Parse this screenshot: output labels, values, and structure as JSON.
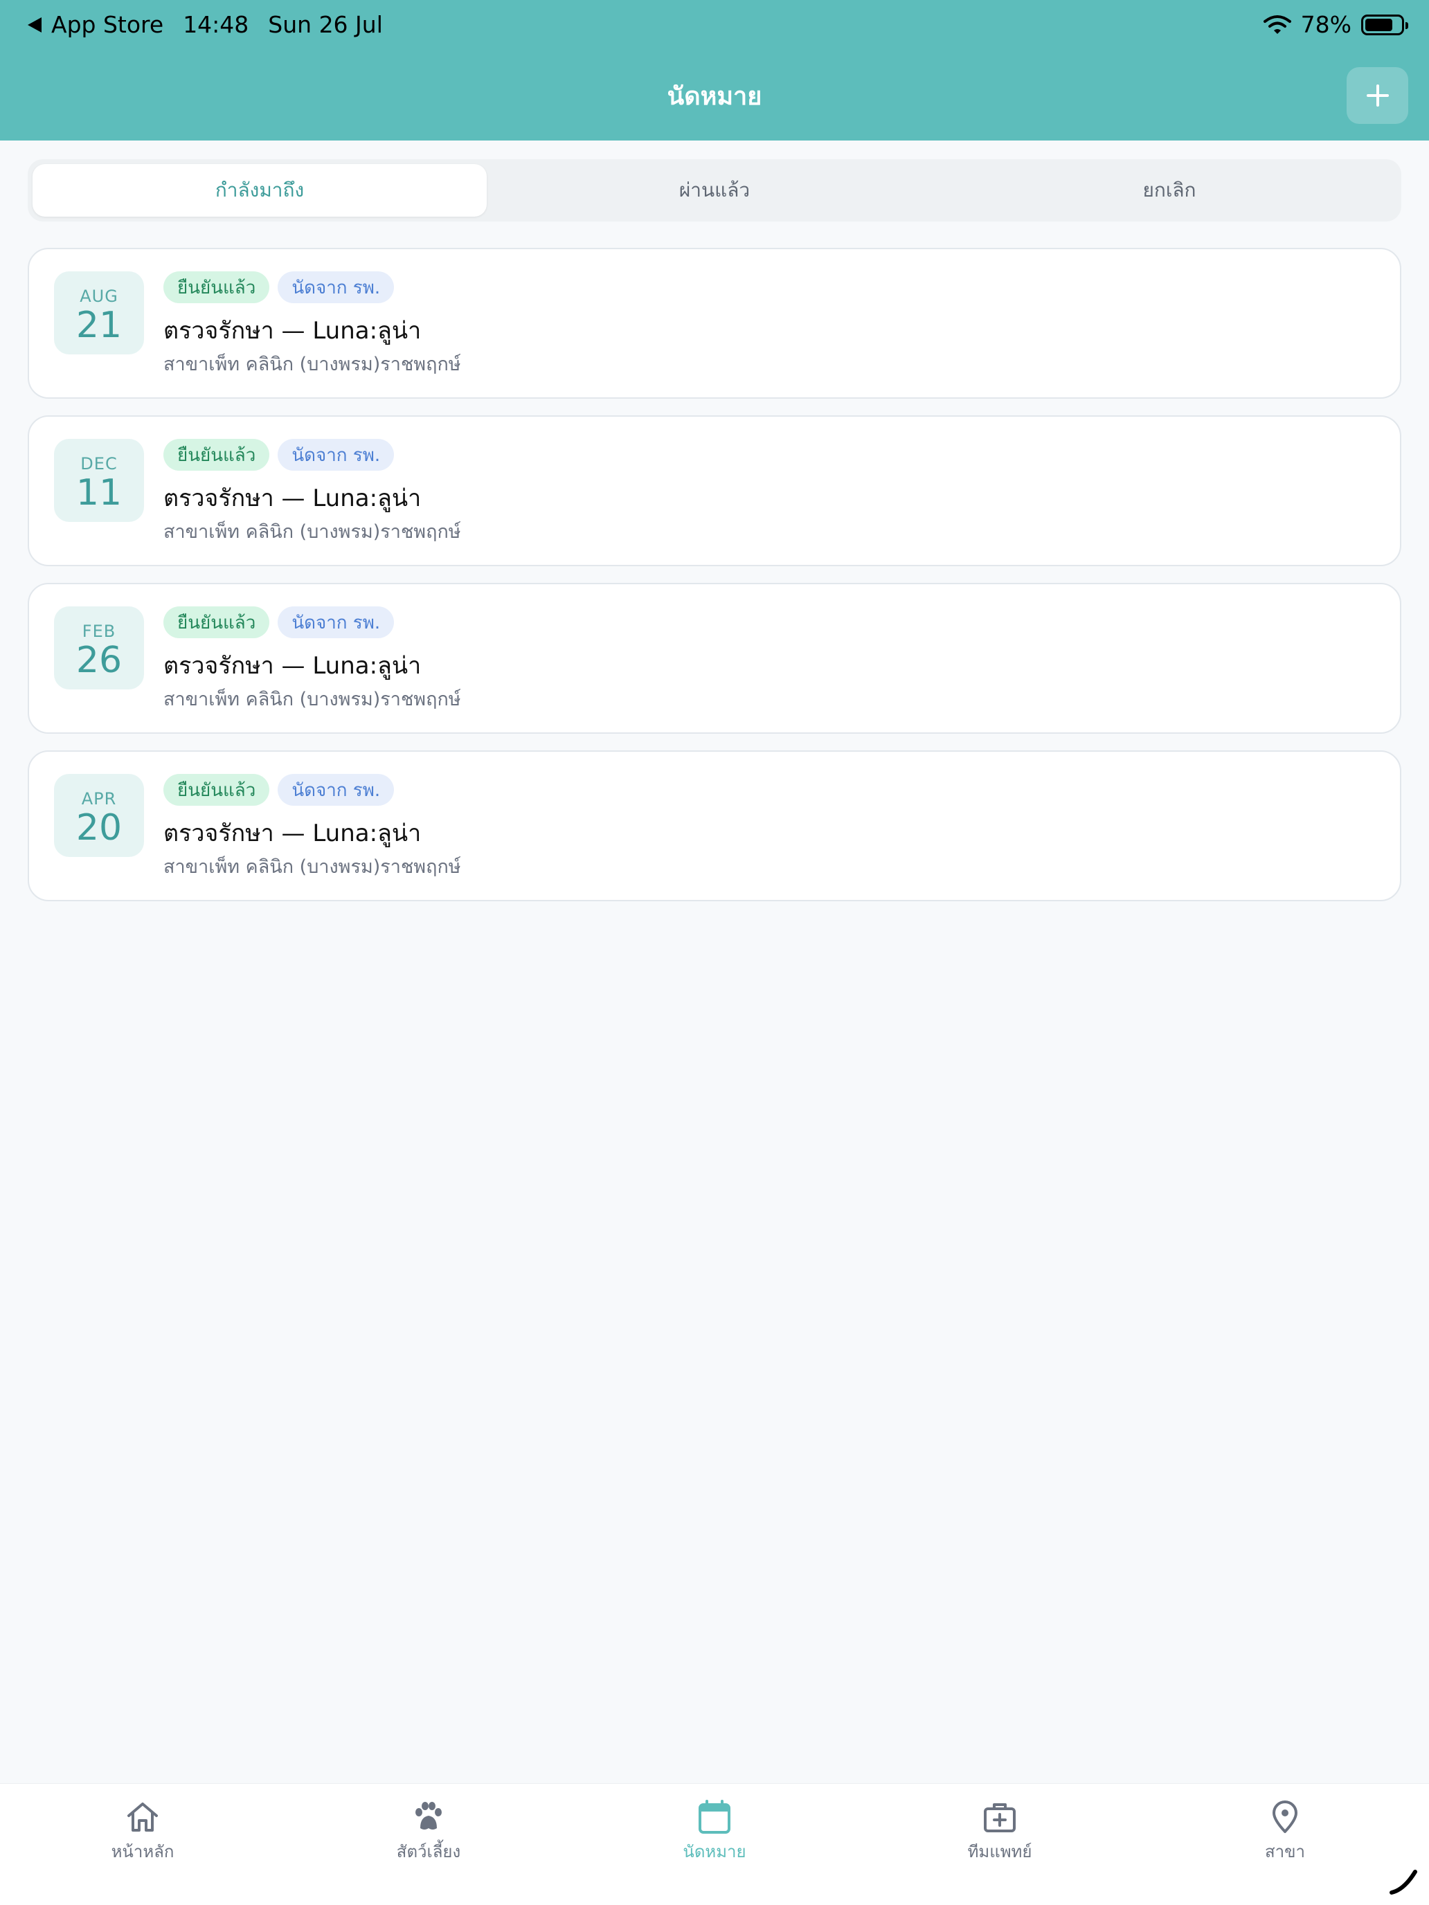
{
  "status_bar": {
    "back_app": "App Store",
    "time": "14:48",
    "date": "Sun 26 Jul",
    "battery_percent": "78%",
    "battery_level": 0.78,
    "wifi_icon": "wifi-icon"
  },
  "header": {
    "title": "นัดหมาย",
    "add_icon": "plus-icon",
    "background_color": "#5dbdbb"
  },
  "segments": [
    {
      "label": "กำลังมาถึง",
      "active": true
    },
    {
      "label": "ผ่านแล้ว",
      "active": false
    },
    {
      "label": "ยกเลิก",
      "active": false
    }
  ],
  "appointments": [
    {
      "month": "AUG",
      "day": "21",
      "status_badge": "ยืนยันแล้ว",
      "source_badge": "นัดจาก รพ.",
      "title": "ตรวจรักษา — Luna:ลูน่า",
      "branch": "สาขาเพ็ท คลินิก (บางพรม)ราชพฤกษ์"
    },
    {
      "month": "DEC",
      "day": "11",
      "status_badge": "ยืนยันแล้ว",
      "source_badge": "นัดจาก รพ.",
      "title": "ตรวจรักษา — Luna:ลูน่า",
      "branch": "สาขาเพ็ท คลินิก (บางพรม)ราชพฤกษ์"
    },
    {
      "month": "FEB",
      "day": "26",
      "status_badge": "ยืนยันแล้ว",
      "source_badge": "นัดจาก รพ.",
      "title": "ตรวจรักษา — Luna:ลูน่า",
      "branch": "สาขาเพ็ท คลินิก (บางพรม)ราชพฤกษ์"
    },
    {
      "month": "APR",
      "day": "20",
      "status_badge": "ยืนยันแล้ว",
      "source_badge": "นัดจาก รพ.",
      "title": "ตรวจรักษา — Luna:ลูน่า",
      "branch": "สาขาเพ็ท คลินิก (บางพรม)ราชพฤกษ์"
    }
  ],
  "tab_bar": {
    "items": [
      {
        "label": "หน้าหลัก",
        "icon": "home-icon",
        "active": false
      },
      {
        "label": "สัตว์เลี้ยง",
        "icon": "paw-icon",
        "active": false
      },
      {
        "label": "นัดหมาย",
        "icon": "calendar-icon",
        "active": true
      },
      {
        "label": "ทีมแพทย์",
        "icon": "medical-kit-icon",
        "active": false
      },
      {
        "label": "สาขา",
        "icon": "location-pin-icon",
        "active": false
      }
    ]
  },
  "colors": {
    "accent": "#5dbdbb",
    "accent_text": "#3e9c9a",
    "confirmed_badge_bg": "#d6f5e4",
    "source_badge_bg": "#e7eefb"
  }
}
